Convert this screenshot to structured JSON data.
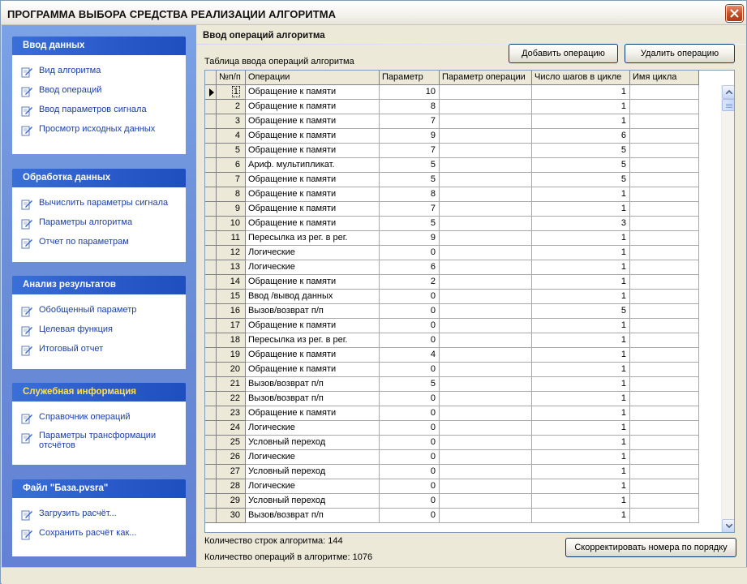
{
  "window": {
    "title": "ПРОГРАММА ВЫБОРА СРЕДСТВА РЕАЛИЗАЦИИ АЛГОРИТМА"
  },
  "sidebar": {
    "groups": [
      {
        "title": "Ввод данных",
        "items": [
          "Вид алгоритма",
          "Ввод операций",
          "Ввод параметров сигнала",
          "Просмотр исходных данных"
        ]
      },
      {
        "title": "Обработка данных",
        "items": [
          "Вычислить параметры сигнала",
          "Параметры алгоритма",
          "Отчет по параметрам"
        ]
      },
      {
        "title": "Анализ результатов",
        "items": [
          "Обобщенный параметр",
          "Целевая функция",
          "Итоговый отчет"
        ]
      },
      {
        "title": "Служебная информация",
        "items": [
          "Справочник операций",
          "Параметры трансформации отсчётов"
        ]
      },
      {
        "title": "Файл \"База.pvsra\"",
        "items": [
          "Загрузить расчёт...",
          "Сохранить расчёт как..."
        ]
      }
    ]
  },
  "main": {
    "title": "Ввод операций алгоритма",
    "add_button": "Добавить операцию",
    "delete_button": "Удалить операцию",
    "table_caption": "Таблица ввода операций алгоритма",
    "columns": [
      "№п/п",
      "Операции",
      "Параметр",
      "Параметр операции",
      "Число шагов в цикле",
      "Имя цикла"
    ],
    "rows": [
      [
        "1",
        "Обращение к памяти",
        "10",
        "",
        "1",
        ""
      ],
      [
        "2",
        "Обращение к памяти",
        "8",
        "",
        "1",
        ""
      ],
      [
        "3",
        "Обращение к памяти",
        "7",
        "",
        "1",
        ""
      ],
      [
        "4",
        "Обращение к памяти",
        "9",
        "",
        "6",
        ""
      ],
      [
        "5",
        "Обращение к памяти",
        "7",
        "",
        "5",
        ""
      ],
      [
        "6",
        "Ариф. мультипликат.",
        "5",
        "",
        "5",
        ""
      ],
      [
        "7",
        "Обращение к памяти",
        "5",
        "",
        "5",
        ""
      ],
      [
        "8",
        "Обращение к памяти",
        "8",
        "",
        "1",
        ""
      ],
      [
        "9",
        "Обращение к памяти",
        "7",
        "",
        "1",
        ""
      ],
      [
        "10",
        "Обращение к памяти",
        "5",
        "",
        "3",
        ""
      ],
      [
        "11",
        "Пересылка из рег. в рег.",
        "9",
        "",
        "1",
        ""
      ],
      [
        "12",
        "Логические",
        "0",
        "",
        "1",
        ""
      ],
      [
        "13",
        "Логические",
        "6",
        "",
        "1",
        ""
      ],
      [
        "14",
        "Обращение к памяти",
        "2",
        "",
        "1",
        ""
      ],
      [
        "15",
        "Ввод /вывод данных",
        "0",
        "",
        "1",
        ""
      ],
      [
        "16",
        "Вызов/возврат п/п",
        "0",
        "",
        "5",
        ""
      ],
      [
        "17",
        "Обращение к памяти",
        "0",
        "",
        "1",
        ""
      ],
      [
        "18",
        "Пересылка из рег. в рег.",
        "0",
        "",
        "1",
        ""
      ],
      [
        "19",
        "Обращение к памяти",
        "4",
        "",
        "1",
        ""
      ],
      [
        "20",
        "Обращение к памяти",
        "0",
        "",
        "1",
        ""
      ],
      [
        "21",
        "Вызов/возврат п/п",
        "5",
        "",
        "1",
        ""
      ],
      [
        "22",
        "Вызов/возврат п/п",
        "0",
        "",
        "1",
        ""
      ],
      [
        "23",
        "Обращение к памяти",
        "0",
        "",
        "1",
        ""
      ],
      [
        "24",
        "Логические",
        "0",
        "",
        "1",
        ""
      ],
      [
        "25",
        "Условный переход",
        "0",
        "",
        "1",
        ""
      ],
      [
        "26",
        "Логические",
        "0",
        "",
        "1",
        ""
      ],
      [
        "27",
        "Условный переход",
        "0",
        "",
        "1",
        ""
      ],
      [
        "28",
        "Логические",
        "0",
        "",
        "1",
        ""
      ],
      [
        "29",
        "Условный переход",
        "0",
        "",
        "1",
        ""
      ],
      [
        "30",
        "Вызов/возврат п/п",
        "0",
        "",
        "1",
        ""
      ]
    ],
    "rows_count_label": "Количество строк алгоритма: 144",
    "ops_count_label": "Количество операций в алгоритме:  1076",
    "renumber_button": "Скорректировать номера по порядку"
  },
  "icons": {
    "sidebar_item": "pencil-document-icon",
    "close": "close-icon"
  },
  "colors": {
    "sidebar_bg": "#6b8fd8",
    "group_header": "#2958c8",
    "special_header_text": "#ffe34d",
    "link": "#1b3fa8"
  }
}
